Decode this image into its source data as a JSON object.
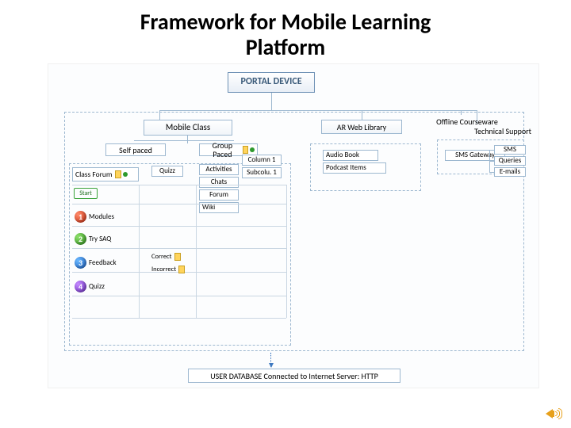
{
  "title_line1": "Framework for Mobile Learning",
  "title_line2": "Platform",
  "portal": "PORTAL DEVICE",
  "main_branches": {
    "mobile_class": "Mobile Class",
    "ar_lib": "AR Web Library",
    "offline": "Offline Courseware",
    "tech_support": "Technical Support"
  },
  "mobile_class": {
    "self_paced": "Self paced",
    "group_paced": "Group Paced",
    "class_forum": "Class Forum",
    "quizz": "Quizz",
    "activities": "Activities",
    "column": "Column 1",
    "subcolumn": "Subcolu. 1",
    "chats": "Chats",
    "forum": "Forum",
    "wiki": "Wiki",
    "rows": {
      "start": "Start",
      "modules": "Modules",
      "try_saq": "Try SAQ",
      "feedback": "Feedback",
      "quizz2": "Quizz"
    },
    "feedback": {
      "correct": "Correct",
      "incorrect": "Incorrect"
    }
  },
  "ar_library": {
    "audio_book": "Audio Book",
    "podcast": "Podcast Items"
  },
  "offline_courseware": {
    "sms_gateway": "SMS Gateway"
  },
  "technical_support": {
    "sms": "SMS",
    "queries": "Queries",
    "emails": "E-mails"
  },
  "footer": "USER DATABASE Connected to Internet Server: HTTP"
}
